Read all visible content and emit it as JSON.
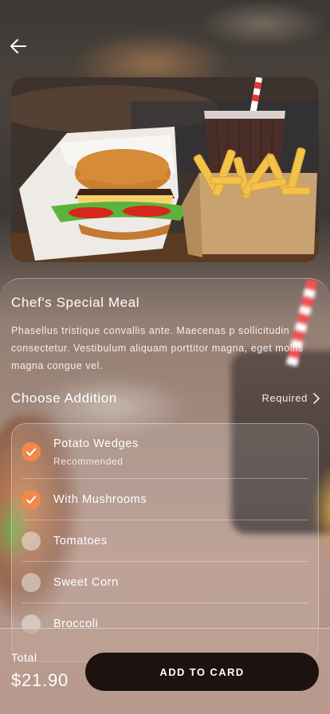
{
  "header": {
    "back_icon": "arrow-left-icon"
  },
  "meal": {
    "title": "Chef's Special Meal",
    "description": "Phasellus tristique convallis ante. Maecenas p sollicitudin consectetur. Vestibulum aliquam porttitor magna, eget mollis magna congue vel."
  },
  "additions": {
    "title": "Choose Addition",
    "required_label": "Required",
    "options": [
      {
        "label": "Potato Wedges",
        "sublabel": "Recommended",
        "checked": true
      },
      {
        "label": "With Mushrooms",
        "checked": true
      },
      {
        "label": "Tomatoes",
        "checked": false
      },
      {
        "label": "Sweet Corn",
        "checked": false
      },
      {
        "label": "Broccoli",
        "checked": false
      }
    ]
  },
  "footer": {
    "total_label": "Total",
    "total_value": "$21.90",
    "cta_label": "ADD TO CARD"
  },
  "colors": {
    "accent": "#f08a4b",
    "cta_background": "#1e1210"
  }
}
